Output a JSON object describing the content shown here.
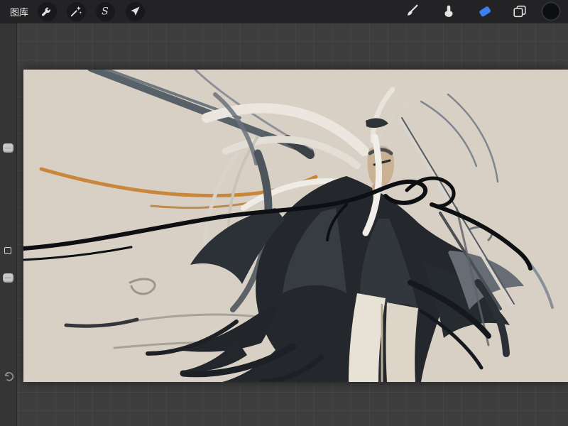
{
  "topbar": {
    "gallery_label": "图库",
    "left_tools": [
      "actions",
      "adjustments",
      "selection",
      "transform"
    ],
    "selection_glyph": "S",
    "right_tools": [
      "paint",
      "smudge",
      "erase",
      "layers",
      "color"
    ],
    "active_tool": "erase",
    "accent_color": "#3d7ef2",
    "current_color": "#0d1013"
  },
  "sidebar": {
    "controls": [
      "brush-size-slider",
      "modify-button",
      "opacity-slider",
      "undo-button"
    ]
  },
  "canvas": {
    "background_color": "#d9d0c5",
    "palette": {
      "ink": "#24282d",
      "ink_mid": "#3a4047",
      "ink_light": "#666d75",
      "accent_orange": "#c8873a",
      "hair_white": "#ebe7e0",
      "skin": "#c9b193",
      "blade_light": "#d9d5cd",
      "blade_dark": "#565b62"
    }
  }
}
